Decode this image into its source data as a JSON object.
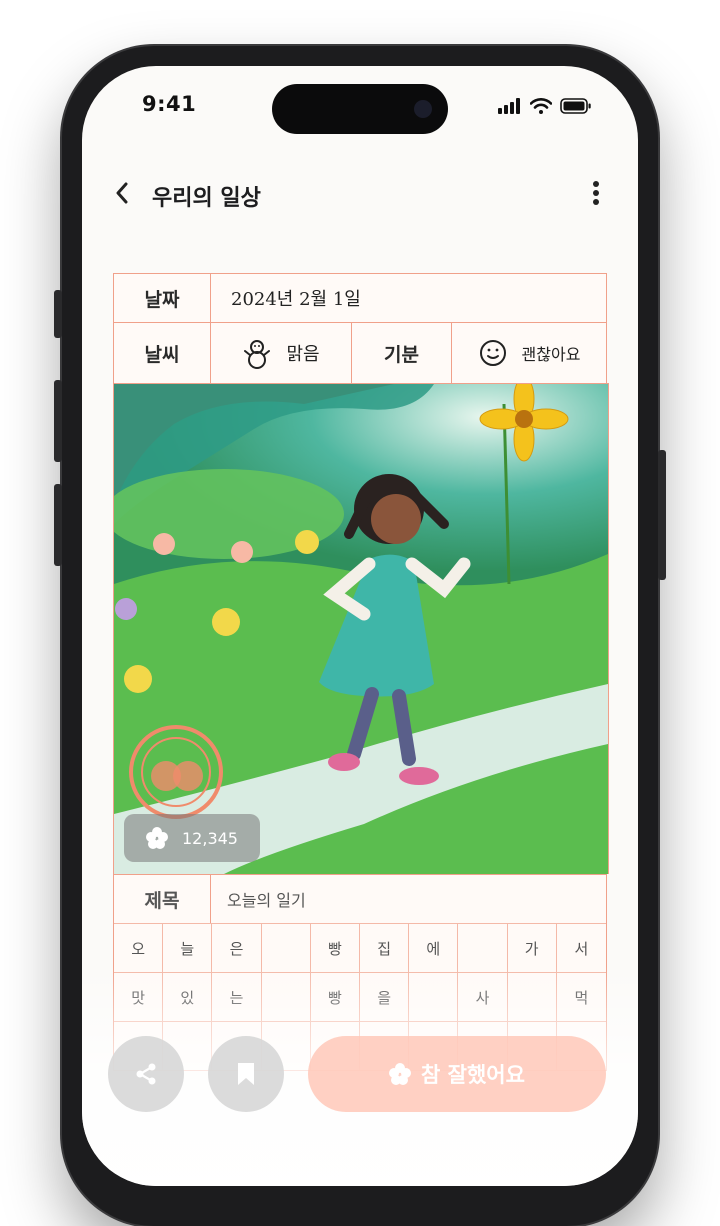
{
  "status_bar": {
    "time": "9:41"
  },
  "header": {
    "back_icon": "chevron-left-icon",
    "title": "우리의 일상",
    "more_icon": "more-vertical-icon"
  },
  "diary": {
    "date_label": "날짜",
    "date_value": "2024년 2월 1일",
    "weather_label": "날씨",
    "weather_icon": "snowman-icon",
    "weather_value": "맑음",
    "mood_label": "기분",
    "mood_icon": "smiley-face-icon",
    "mood_value": "괜찮아요",
    "stamp_text": "참 잘했어요",
    "likes_count": "12,345",
    "title_label": "제목",
    "title_value": "오늘의 일기",
    "manuscript_cells": [
      "오",
      "늘",
      "은",
      "",
      "빵",
      "집",
      "에",
      "",
      "가",
      "서",
      "맛",
      "있",
      "는",
      "",
      "빵",
      "을",
      "",
      "사",
      "",
      "먹",
      "",
      "",
      "",
      "",
      "",
      "",
      "",
      "",
      "",
      ""
    ]
  },
  "bottom_bar": {
    "share_icon": "share-icon",
    "bookmark_icon": "bookmark-icon",
    "cta_icon": "flower-icon",
    "cta_label": "참 잘했어요"
  },
  "colors": {
    "grid_line": "#f0a08a",
    "cta": "#ffc8b9",
    "paper": "#fffaf7"
  }
}
